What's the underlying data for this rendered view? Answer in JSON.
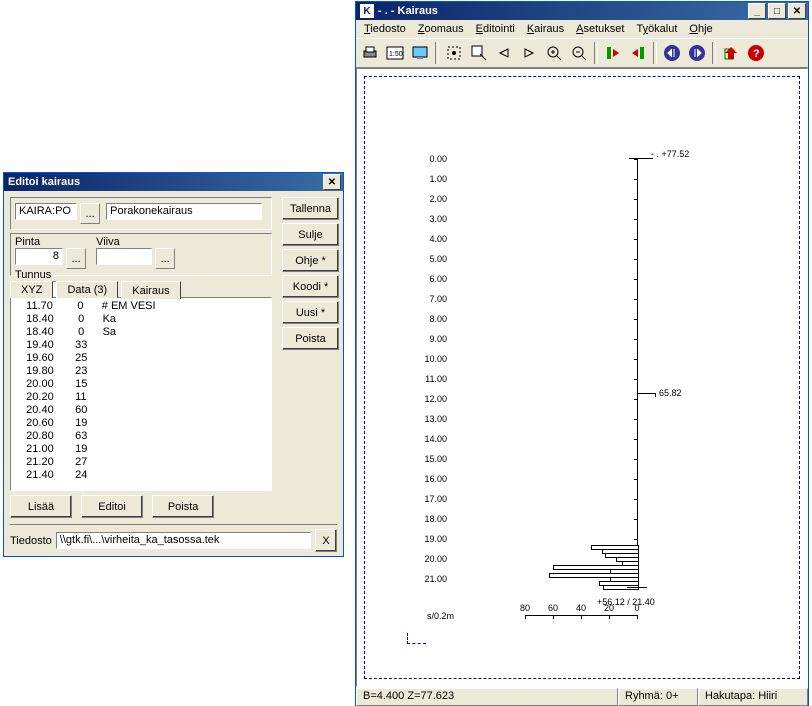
{
  "dialog": {
    "title": "Editoi kairaus",
    "kaira_value": "KAIRA:PO",
    "kaira_label2": "Porakonekairaus",
    "pinta_label": "Pinta",
    "pinta_value": "8",
    "viiva_label": "Viiva",
    "viiva_value": "",
    "tunnus_label": "Tunnus",
    "tunnus_value": "",
    "tabs": {
      "xyz": "XYZ",
      "data": "Data (3)",
      "kairaus": "Kairaus"
    },
    "rows": [
      {
        "a": "11.70",
        "b": "0",
        "c": "# EM VESI"
      },
      {
        "a": "18.40",
        "b": "0",
        "c": "Ka"
      },
      {
        "a": "18.40",
        "b": "0",
        "c": "Sa"
      },
      {
        "a": "19.40",
        "b": "33",
        "c": ""
      },
      {
        "a": "19.60",
        "b": "25",
        "c": ""
      },
      {
        "a": "19.80",
        "b": "23",
        "c": ""
      },
      {
        "a": "20.00",
        "b": "15",
        "c": ""
      },
      {
        "a": "20.20",
        "b": "11",
        "c": ""
      },
      {
        "a": "20.40",
        "b": "60",
        "c": ""
      },
      {
        "a": "20.60",
        "b": "19",
        "c": ""
      },
      {
        "a": "20.80",
        "b": "63",
        "c": ""
      },
      {
        "a": "21.00",
        "b": "19",
        "c": ""
      },
      {
        "a": "21.20",
        "b": "27",
        "c": ""
      },
      {
        "a": "21.40",
        "b": "24",
        "c": ""
      }
    ],
    "buttons": {
      "tallenna": "Tallenna",
      "sulje": "Sulje",
      "ohje": "Ohje *",
      "koodi": "Koodi *",
      "uusi": "Uusi *",
      "poista": "Poista",
      "lisaa": "Lisää",
      "editoi": "Editoi",
      "poista2": "Poista",
      "x": "X",
      "dots": "..."
    },
    "tiedosto_label": "Tiedosto",
    "tiedosto_value": "\\\\gtk.fi\\...\\virheita_ka_tasossa.tek"
  },
  "mainwin": {
    "title": "- . - Kairaus",
    "menus": {
      "tiedosto": "Tiedosto",
      "zoomaus": "Zoomaus",
      "editointi": "Editointi",
      "kairaus": "Kairaus",
      "asetukset": "Asetukset",
      "tyokalut": "Työkalut",
      "ohje": "Ohje"
    },
    "status": {
      "bz": "B=4.400  Z=77.623",
      "ryhma": "Ryhmä: 0+",
      "haku": "Hakutapa: Hiiri"
    }
  },
  "chart_data": {
    "type": "bar",
    "orientation": "horizontal-depth",
    "y_label_col": [
      "0.00",
      "1.00",
      "2.00",
      "3.00",
      "4.00",
      "5.00",
      "6.00",
      "7.00",
      "8.00",
      "9.00",
      "10.00",
      "11.00",
      "12.00",
      "13.00",
      "14.00",
      "15.00",
      "16.00",
      "17.00",
      "18.00",
      "19.00",
      "20.00",
      "21.00"
    ],
    "top_annotation": "- . +77.52",
    "mid_annotation": "65.82",
    "bottom_annotation": "+56.12 / 21.40",
    "xticks": [
      "80",
      "60",
      "40",
      "20",
      "0"
    ],
    "xunit": "s/0.2m",
    "bars": [
      {
        "depth": 19.4,
        "value": 33
      },
      {
        "depth": 19.6,
        "value": 25
      },
      {
        "depth": 19.8,
        "value": 23
      },
      {
        "depth": 20.0,
        "value": 15
      },
      {
        "depth": 20.2,
        "value": 11
      },
      {
        "depth": 20.4,
        "value": 60
      },
      {
        "depth": 20.6,
        "value": 19
      },
      {
        "depth": 20.8,
        "value": 63
      },
      {
        "depth": 21.0,
        "value": 19
      },
      {
        "depth": 21.2,
        "value": 27
      },
      {
        "depth": 21.4,
        "value": 24
      }
    ],
    "mid_line_depth": 11.7
  }
}
